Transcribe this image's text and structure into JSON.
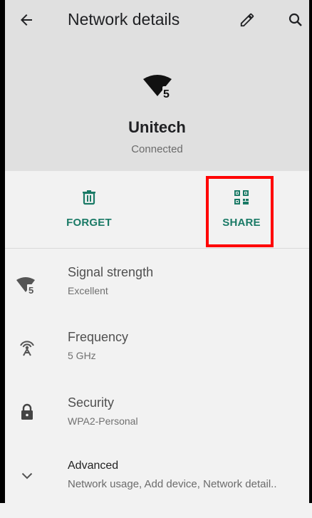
{
  "topbar": {
    "title": "Network details",
    "icons": [
      "back-arrow-icon",
      "edit-pencil-icon",
      "search-icon"
    ]
  },
  "network": {
    "name": "Unitech",
    "status": "Connected",
    "badge": "5"
  },
  "actions": {
    "forget_label": "FORGET",
    "share_label": "SHARE"
  },
  "details": [
    {
      "title": "Signal strength",
      "value": "Excellent",
      "icon": "wifi-signal-icon",
      "badge": "5"
    },
    {
      "title": "Frequency",
      "value": "5 GHz",
      "icon": "antenna-icon"
    },
    {
      "title": "Security",
      "value": "WPA2-Personal",
      "icon": "lock-icon"
    },
    {
      "title": "Advanced",
      "value": "Network usage, Add device, Network detail..",
      "icon": "chevron-down-icon"
    }
  ],
  "colors": {
    "accent": "#1a7a66",
    "highlight": "#ff0000",
    "header_bg": "#e0e0e0"
  }
}
